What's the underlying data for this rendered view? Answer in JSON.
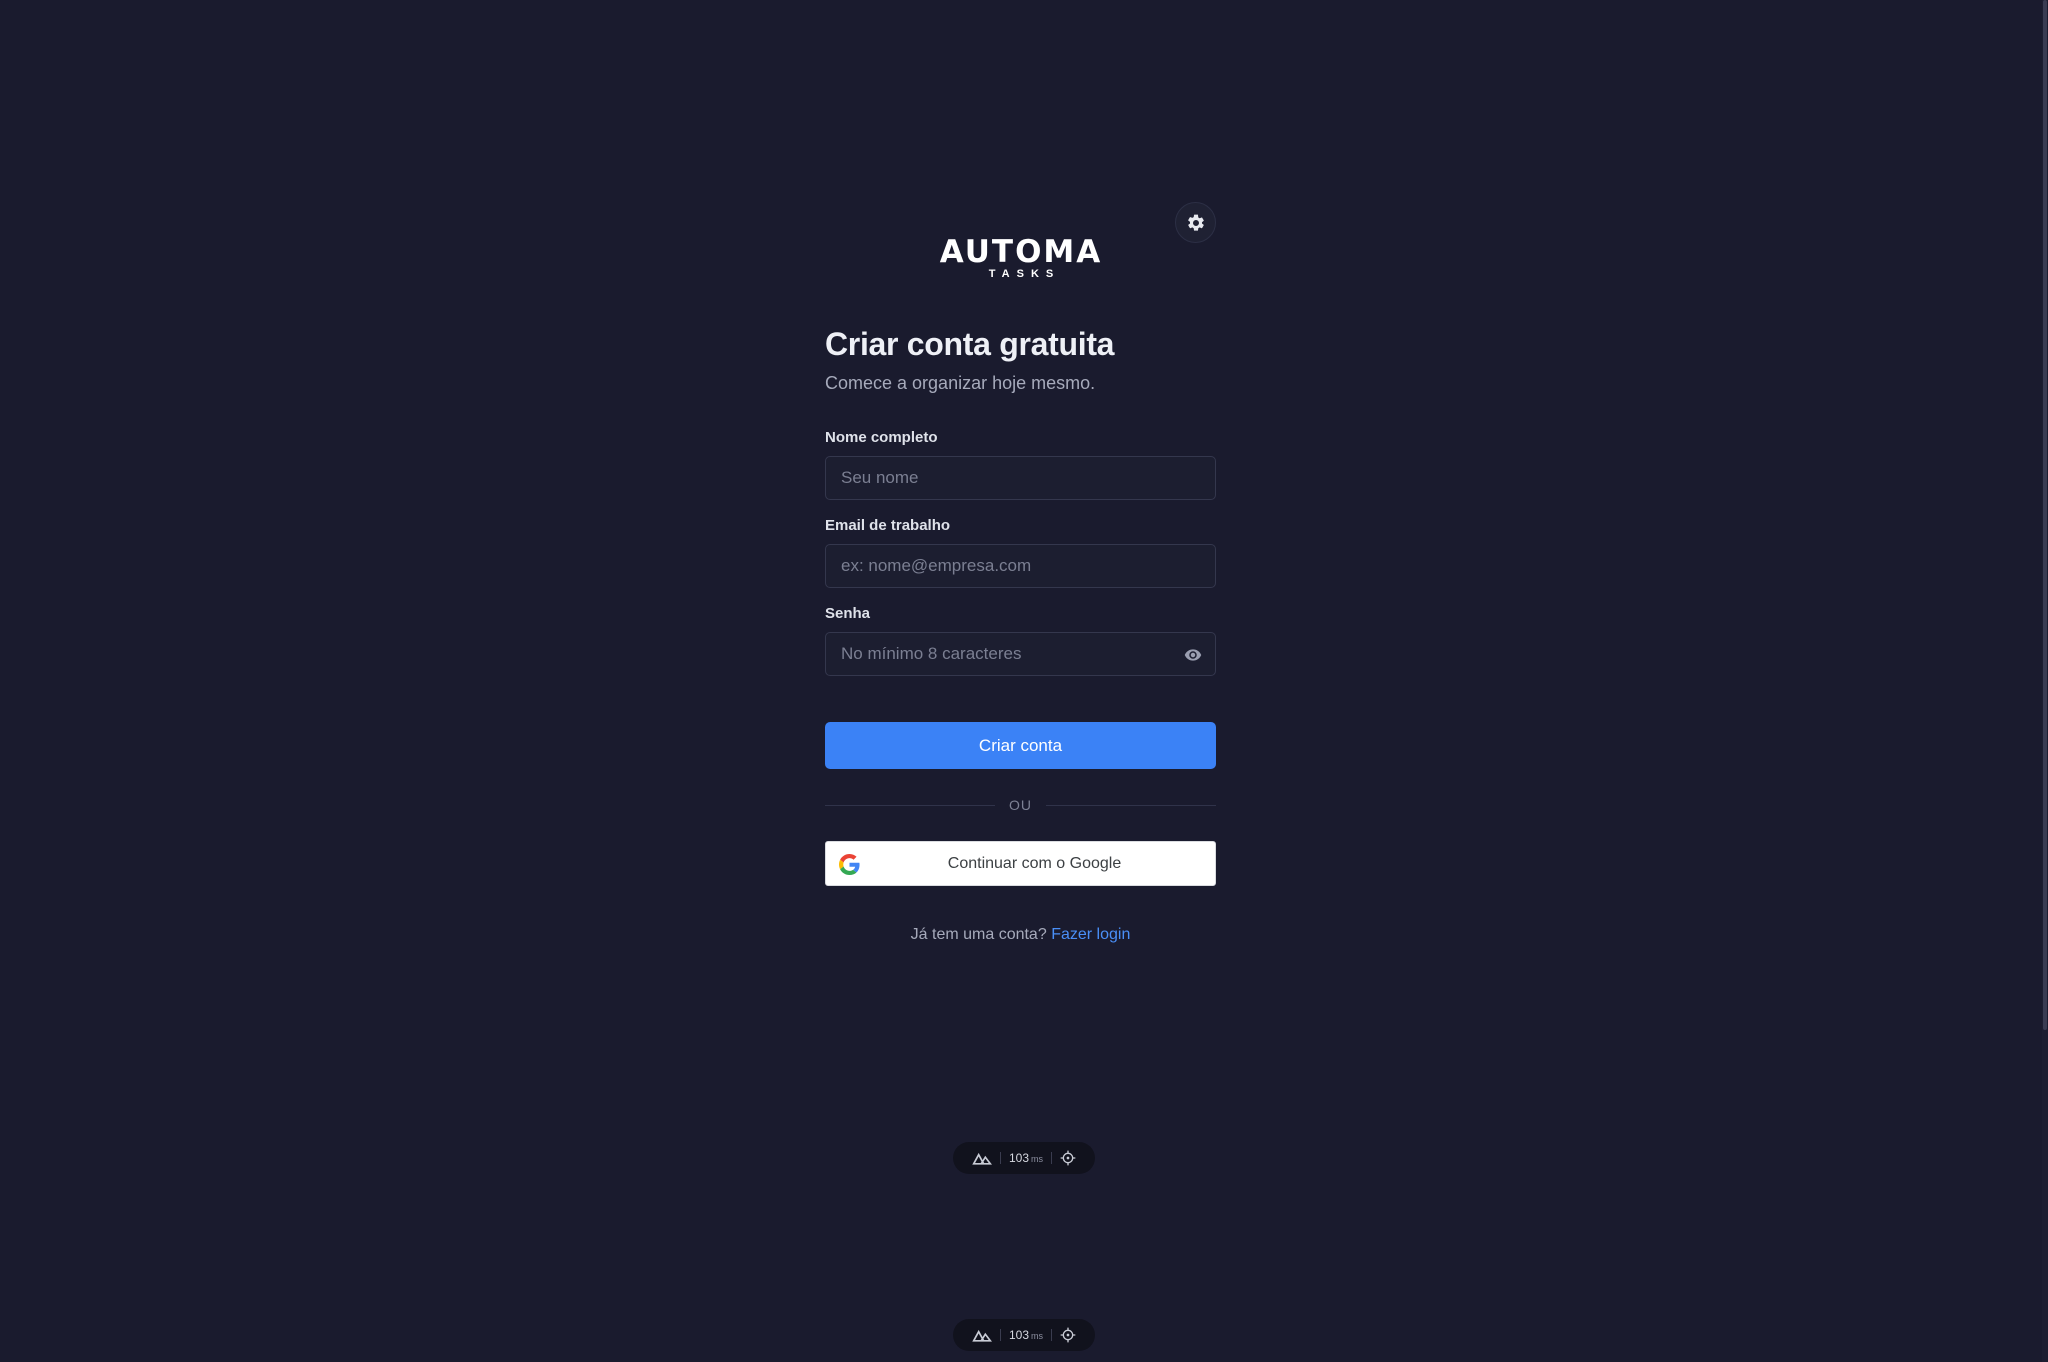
{
  "brand": {
    "logo_main": "AUTOMA",
    "logo_sub": "TASKS"
  },
  "header": {
    "title": "Criar conta gratuita",
    "subtitle": "Comece a organizar hoje mesmo."
  },
  "form": {
    "name_label": "Nome completo",
    "name_placeholder": "Seu nome",
    "email_label": "Email de trabalho",
    "email_placeholder": "ex: nome@empresa.com",
    "password_label": "Senha",
    "password_placeholder": "No mínimo 8 caracteres",
    "submit_label": "Criar conta"
  },
  "divider": {
    "text": "OU"
  },
  "google": {
    "label": "Continuar com o Google"
  },
  "signin": {
    "prompt": "Já tem uma conta?",
    "link": "Fazer login"
  },
  "devbars": [
    {
      "value": "103",
      "unit": "ms"
    },
    {
      "value": "103",
      "unit": "ms"
    }
  ],
  "colors": {
    "background": "#1a1b2e",
    "primary": "#3b82f6",
    "link": "#4a8ff7"
  },
  "icons": {
    "theme_toggle": "gear-icon",
    "password_toggle": "eye-icon",
    "google": "google-icon",
    "devbar_logo": "nuxt-icon",
    "devbar_inspect": "crosshair-icon"
  }
}
